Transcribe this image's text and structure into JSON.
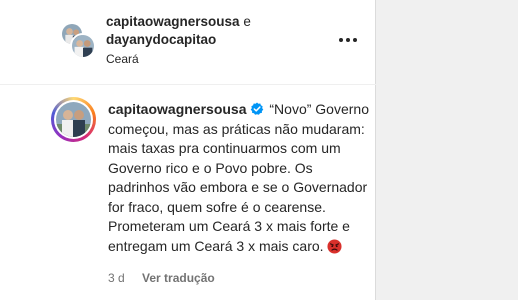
{
  "post_header": {
    "author1": "capitaowagnersousa",
    "connector": "e",
    "author2": "dayanydocapitao",
    "location": "Ceará"
  },
  "comment": {
    "username": "capitaowagnersousa",
    "text": "“Novo” Governo começou, mas as práticas não mudaram: mais taxas pra continuarmos com um Governo rico e o Povo pobre. Os padrinhos vão embora e se o Governador for fraco, quem sofre é o cearense. Prometeram um Ceará 3 x mais forte e entregam um Ceará 3 x mais caro.",
    "time_ago": "3 d",
    "translate_label": "Ver tradução"
  },
  "icons": {
    "more": "more-options-icon",
    "verified": "verified-badge-icon",
    "emoji": "angry-face-emoji"
  },
  "colors": {
    "verified_blue": "#0095f6",
    "muted_text": "#737373",
    "emoji_red": "#d9302b"
  }
}
